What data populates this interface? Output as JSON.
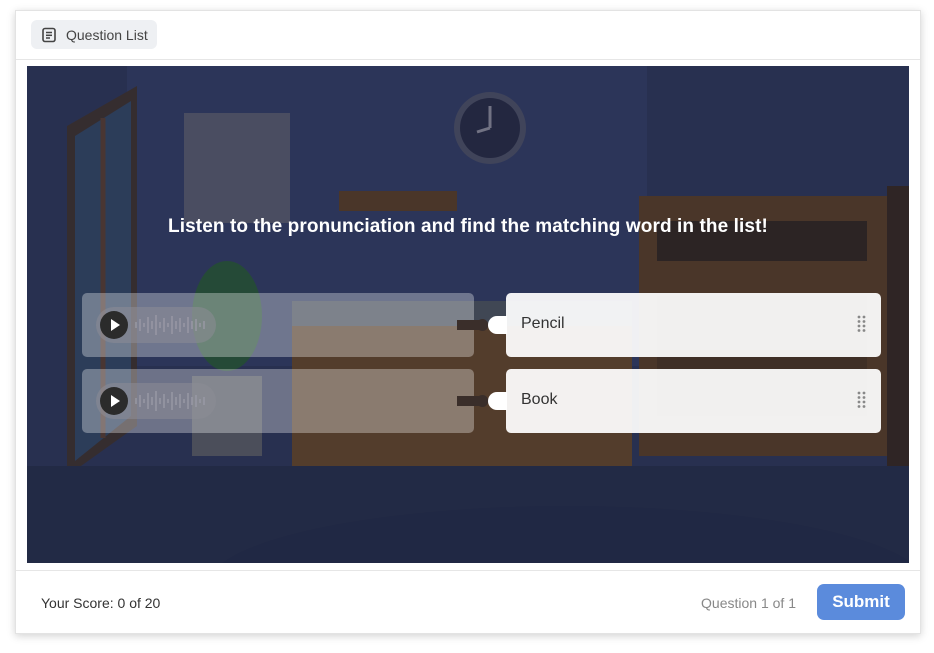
{
  "header": {
    "question_list_label": "Question List",
    "question_list_icon": "list-document-icon"
  },
  "question": {
    "prompt": "Listen to the pronunciation and find the matching word in the list!"
  },
  "pairs": [
    {
      "audio_icon": "play-icon",
      "word": "Pencil"
    },
    {
      "audio_icon": "play-icon",
      "word": "Book"
    }
  ],
  "footer": {
    "score_text": "Your Score: 0 of 20",
    "question_counter": "Question 1 of 1",
    "submit_label": "Submit"
  },
  "colors": {
    "accent": "#5b8bdc",
    "overlay_card_right": "#ffffff",
    "scene_dark": "#2d3550"
  }
}
